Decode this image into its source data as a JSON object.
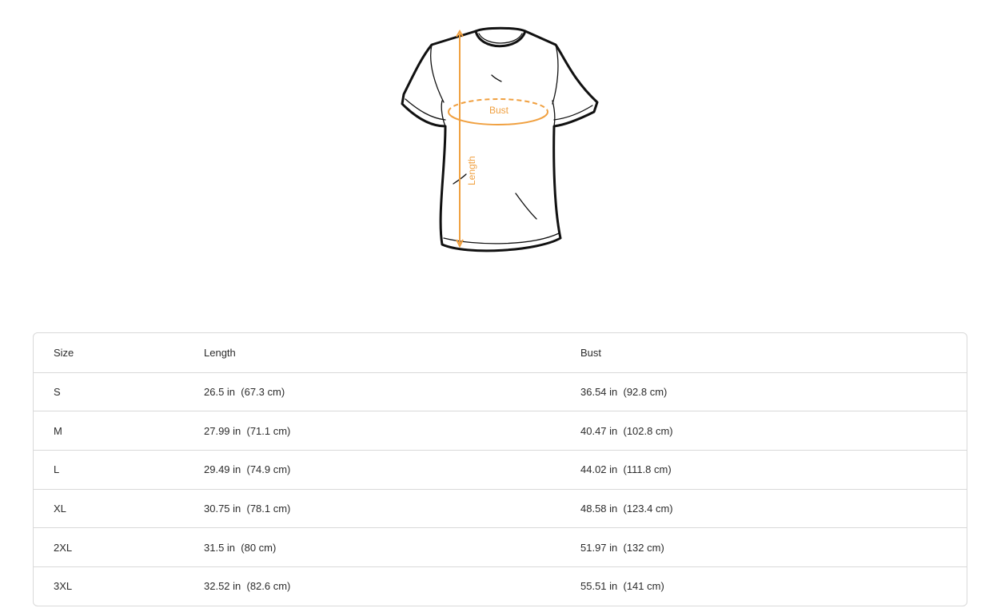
{
  "diagram": {
    "bust_label": "Bust",
    "length_label": "Length",
    "accent_color": "#f0a040",
    "outline_color": "#111111"
  },
  "table": {
    "headers": [
      "Size",
      "Length",
      "Bust"
    ],
    "rows": [
      {
        "size": "S",
        "length": "26.5 in  (67.3 cm)",
        "bust": "36.54 in  (92.8 cm)"
      },
      {
        "size": "M",
        "length": "27.99 in  (71.1 cm)",
        "bust": "40.47 in  (102.8 cm)"
      },
      {
        "size": "L",
        "length": "29.49 in  (74.9 cm)",
        "bust": "44.02 in  (111.8 cm)"
      },
      {
        "size": "XL",
        "length": "30.75 in  (78.1 cm)",
        "bust": "48.58 in  (123.4 cm)"
      },
      {
        "size": "2XL",
        "length": "31.5 in  (80 cm)",
        "bust": "51.97 in  (132 cm)"
      },
      {
        "size": "3XL",
        "length": "32.52 in  (82.6 cm)",
        "bust": "55.51 in  (141 cm)"
      }
    ]
  }
}
